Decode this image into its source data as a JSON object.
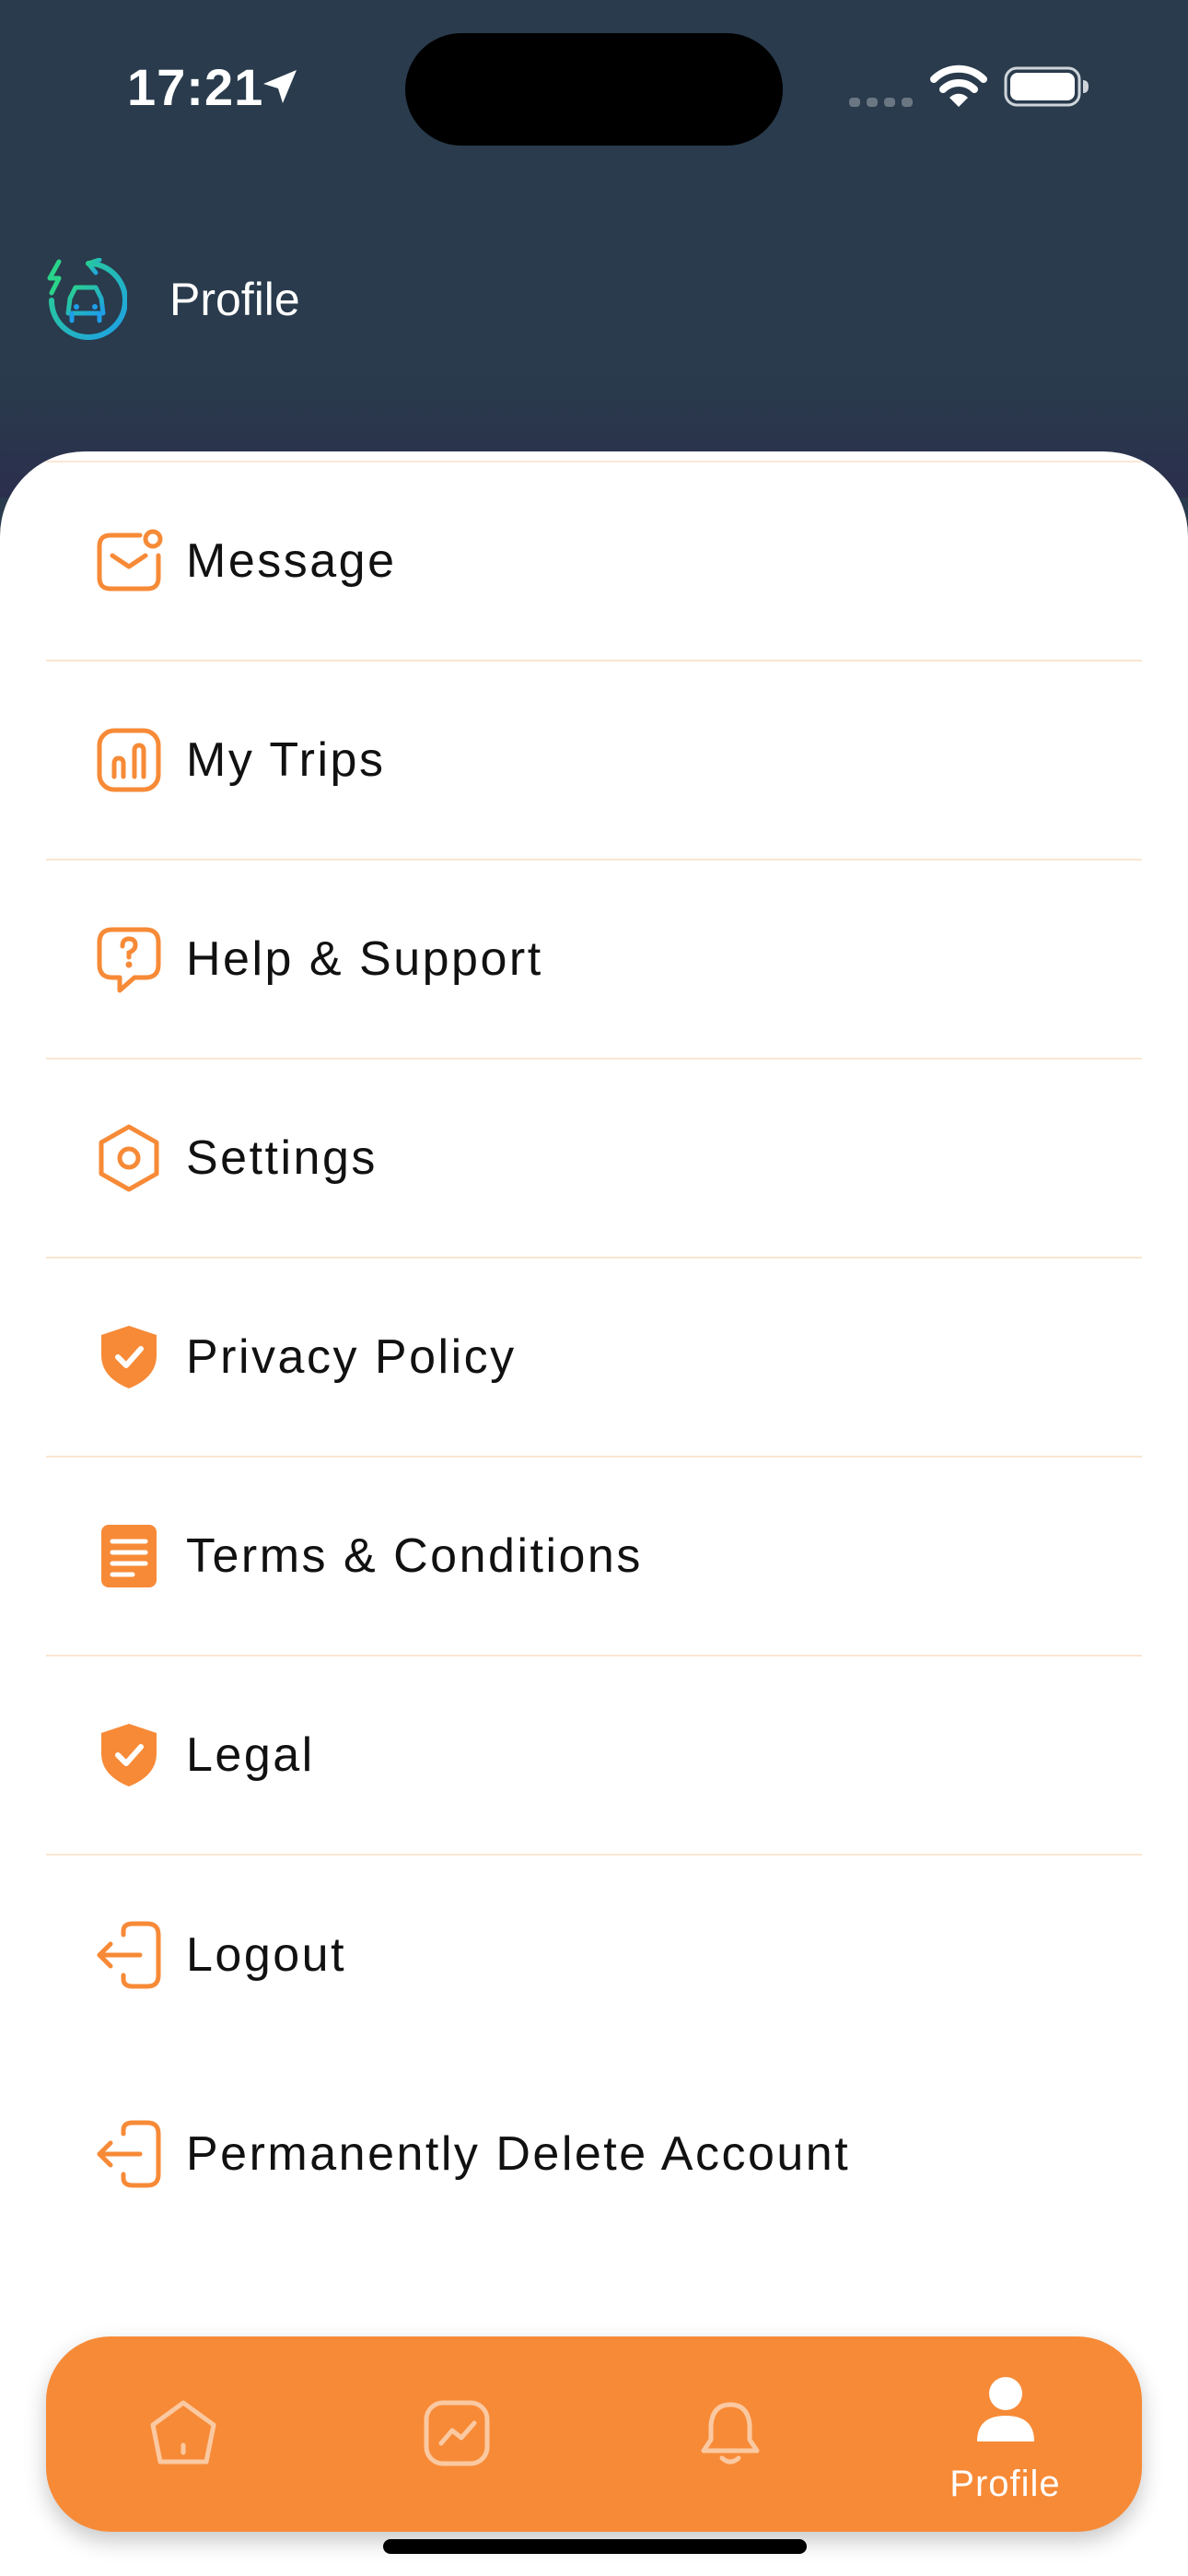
{
  "status_bar": {
    "time": "17:21"
  },
  "header": {
    "title": "Profile"
  },
  "menu": {
    "items": [
      {
        "label": "Message",
        "icon": "message-icon"
      },
      {
        "label": "My Trips",
        "icon": "trips-icon"
      },
      {
        "label": "Help & Support",
        "icon": "help-icon"
      },
      {
        "label": "Settings",
        "icon": "settings-icon"
      },
      {
        "label": "Privacy Policy",
        "icon": "shield-check-icon"
      },
      {
        "label": "Terms & Conditions",
        "icon": "document-icon"
      },
      {
        "label": "Legal",
        "icon": "shield-check-icon"
      },
      {
        "label": "Logout",
        "icon": "logout-icon"
      },
      {
        "label": "Permanently Delete Account",
        "icon": "logout-icon"
      }
    ]
  },
  "tabbar": {
    "tabs": [
      {
        "icon": "home-icon",
        "label": ""
      },
      {
        "icon": "chart-icon",
        "label": ""
      },
      {
        "icon": "bell-icon",
        "label": ""
      },
      {
        "icon": "user-icon",
        "label": "Profile"
      }
    ],
    "active_tab": "Profile"
  },
  "colors": {
    "header_bg": "#293b4c",
    "accent": "#f78a37",
    "divider": "#fbe6d2",
    "text": "#111111"
  }
}
